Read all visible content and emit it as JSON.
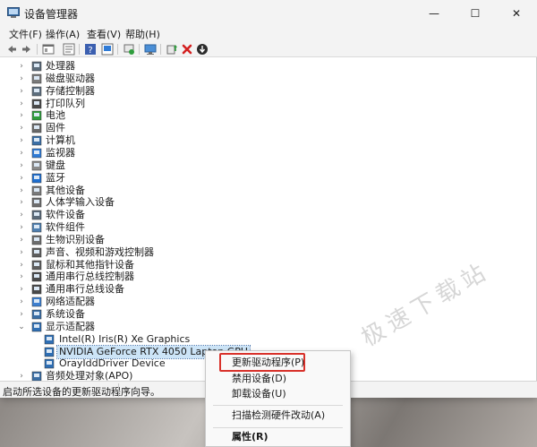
{
  "window": {
    "title": "设备管理器",
    "controls": {
      "minimize": "—",
      "maximize": "☐",
      "close": "✕"
    }
  },
  "menubar": {
    "items": [
      "文件(F)",
      "操作(A)",
      "查看(V)",
      "帮助(H)"
    ]
  },
  "toolbar": {
    "buttons": [
      "back-icon",
      "forward-icon",
      "properties-window-icon",
      "show-hidden-icon",
      "help-icon",
      "scan-hardware-icon",
      "update-driver-icon",
      "monitor-icon",
      "enable-device-icon",
      "uninstall-icon",
      "download-driver-icon"
    ]
  },
  "tree": {
    "categories": [
      {
        "label": "处理器",
        "icon": "processor-icon"
      },
      {
        "label": "磁盘驱动器",
        "icon": "disk-drive-icon"
      },
      {
        "label": "存储控制器",
        "icon": "storage-controller-icon"
      },
      {
        "label": "打印队列",
        "icon": "printer-icon"
      },
      {
        "label": "电池",
        "icon": "battery-icon"
      },
      {
        "label": "固件",
        "icon": "firmware-icon"
      },
      {
        "label": "计算机",
        "icon": "computer-icon"
      },
      {
        "label": "监视器",
        "icon": "monitor-icon"
      },
      {
        "label": "键盘",
        "icon": "keyboard-icon"
      },
      {
        "label": "蓝牙",
        "icon": "bluetooth-icon"
      },
      {
        "label": "其他设备",
        "icon": "other-devices-icon"
      },
      {
        "label": "人体学输入设备",
        "icon": "hid-icon"
      },
      {
        "label": "软件设备",
        "icon": "software-device-icon"
      },
      {
        "label": "软件组件",
        "icon": "software-component-icon"
      },
      {
        "label": "生物识别设备",
        "icon": "biometric-icon"
      },
      {
        "label": "声音、视频和游戏控制器",
        "icon": "sound-icon"
      },
      {
        "label": "鼠标和其他指针设备",
        "icon": "mouse-icon"
      },
      {
        "label": "通用串行总线控制器",
        "icon": "usb-icon"
      },
      {
        "label": "通用串行总线设备",
        "icon": "usb-device-icon"
      },
      {
        "label": "网络适配器",
        "icon": "network-adapter-icon"
      },
      {
        "label": "系统设备",
        "icon": "system-device-icon"
      },
      {
        "label": "显示适配器",
        "icon": "display-adapter-icon",
        "expanded": true
      }
    ],
    "display_children": [
      {
        "label": "Intel(R) Iris(R) Xe Graphics"
      },
      {
        "label": "NVIDIA GeForce RTX 4050 Laptop GPU",
        "selected": true
      },
      {
        "label": "OrayIddDriver Device"
      }
    ],
    "partial_row": {
      "label": "音频处理对象(APO)"
    },
    "arrow_collapsed": "›",
    "arrow_expanded": "⌄"
  },
  "watermark": "极速下载站",
  "statusbar": {
    "text": "启动所选设备的更新驱动程序向导。"
  },
  "context_menu": {
    "update": "更新驱动程序(P)",
    "disable": "禁用设备(D)",
    "uninstall": "卸载设备(U)",
    "scan": "扫描检测硬件改动(A)",
    "properties": "属性(R)",
    "highlight_color": "#d8312a"
  }
}
